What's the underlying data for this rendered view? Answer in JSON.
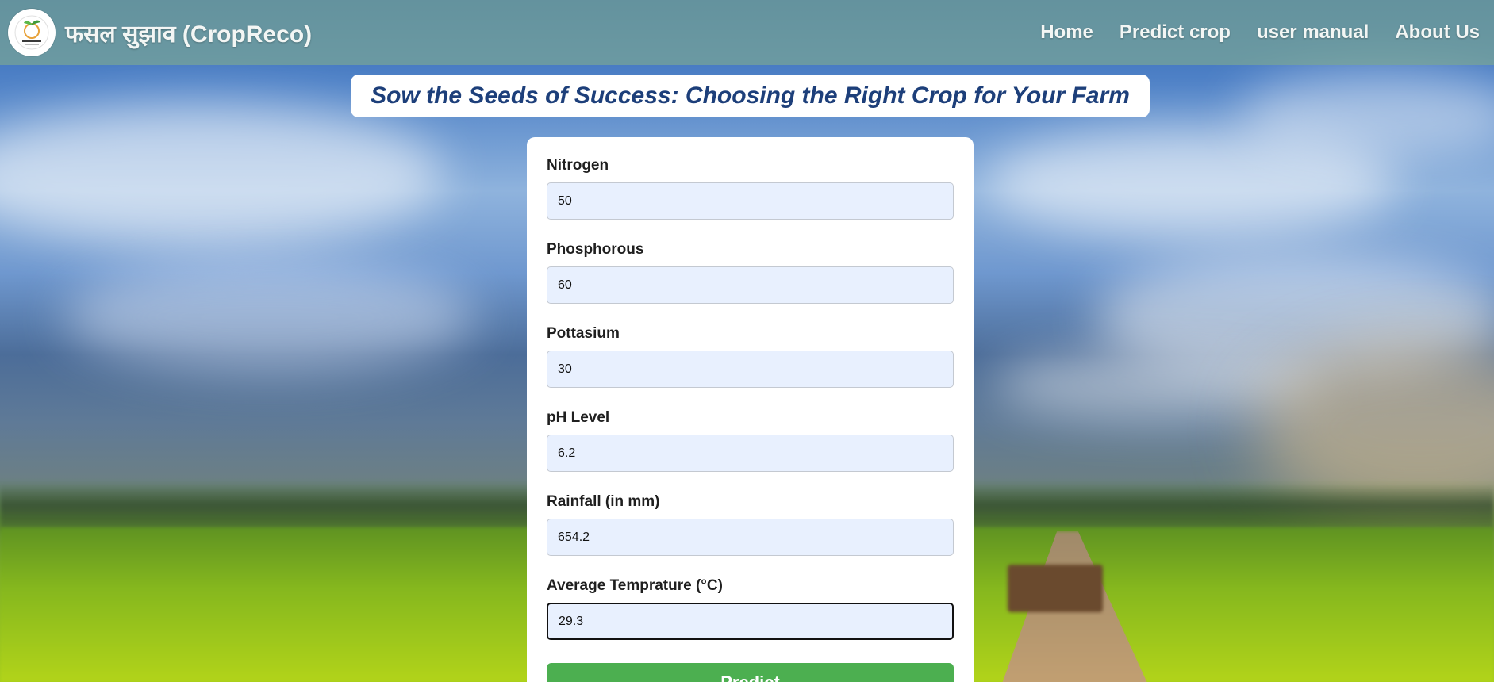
{
  "header": {
    "brand_title": "फसल सुझाव (CropReco)",
    "logo_icon": "crop-leaf-logo-icon",
    "nav": [
      {
        "label": "Home"
      },
      {
        "label": "Predict crop"
      },
      {
        "label": "user manual"
      },
      {
        "label": "About Us"
      }
    ]
  },
  "banner": {
    "text": "Sow the Seeds of Success: Choosing the Right Crop for Your Farm"
  },
  "form": {
    "fields": [
      {
        "label": "Nitrogen",
        "value": "50"
      },
      {
        "label": "Phosphorous",
        "value": "60"
      },
      {
        "label": "Pottasium",
        "value": "30"
      },
      {
        "label": "pH Level",
        "value": "6.2"
      },
      {
        "label": "Rainfall (in mm)",
        "value": "654.2"
      },
      {
        "label": "Average Temprature (°C)",
        "value": "29.3"
      }
    ],
    "submit_label": "Predict"
  },
  "colors": {
    "nav_text": "#f3f6f4",
    "banner_text": "#1d3f7a",
    "input_bg": "#e8f0fe",
    "button_bg": "#4caf50"
  }
}
